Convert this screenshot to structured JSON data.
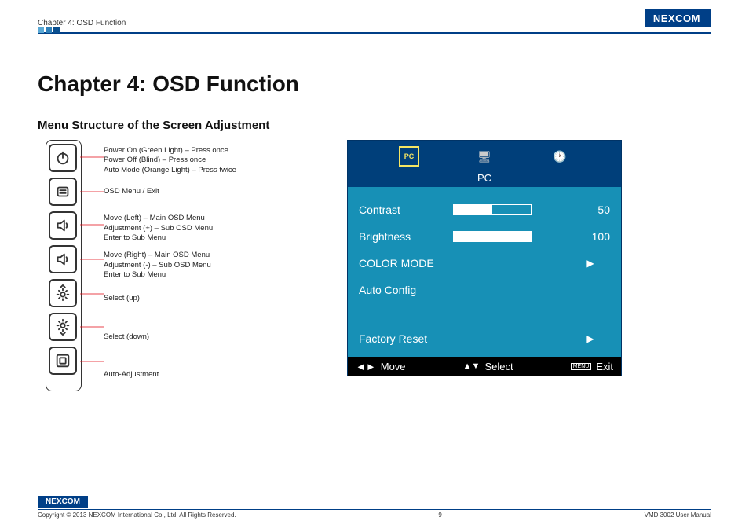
{
  "header": {
    "breadcrumb": "Chapter 4: OSD Function",
    "brand": "NE COM",
    "brand_x": "X"
  },
  "title": "Chapter 4: OSD Function",
  "subtitle": "Menu Structure of the Screen Adjustment",
  "buttons": [
    {
      "name": "power-icon",
      "desc": [
        "Power On (Green Light) – Press once",
        "Power Off (Blind) – Press once",
        "Auto Mode (Orange Light) – Press twice"
      ]
    },
    {
      "name": "osd-menu-icon",
      "desc": [
        "OSD Menu / Exit"
      ]
    },
    {
      "name": "speaker-left-icon",
      "desc": [
        "Move (Left) – Main OSD Menu",
        "Adjustment (+) – Sub OSD Menu",
        "Enter to Sub Menu"
      ]
    },
    {
      "name": "speaker-right-icon",
      "desc": [
        "Move (Right) – Main OSD Menu",
        "Adjustment (-) – Sub OSD Menu",
        "Enter to Sub Menu"
      ]
    },
    {
      "name": "sun-up-icon",
      "desc": [
        "Select (up)"
      ]
    },
    {
      "name": "sun-down-icon",
      "desc": [
        "Select (down)"
      ]
    },
    {
      "name": "auto-adjust-icon",
      "desc": [
        "Auto-Adjustment"
      ]
    }
  ],
  "osd": {
    "tab": "PC",
    "rows": {
      "contrast": {
        "label": "Contrast",
        "value": 50
      },
      "brightness": {
        "label": "Brightness",
        "value": 100
      },
      "colormode": {
        "label": "COLOR MODE"
      },
      "autoconfig": {
        "label": "Auto Config"
      },
      "factory": {
        "label": "Factory Reset"
      }
    },
    "foot": {
      "move": "Move",
      "select": "Select",
      "menu": "MENU",
      "exit": "Exit"
    }
  },
  "footer": {
    "copyright": "Copyright © 2013 NEXCOM International Co., Ltd. All Rights Reserved.",
    "page": "9",
    "doc": "VMD 3002 User Manual"
  }
}
